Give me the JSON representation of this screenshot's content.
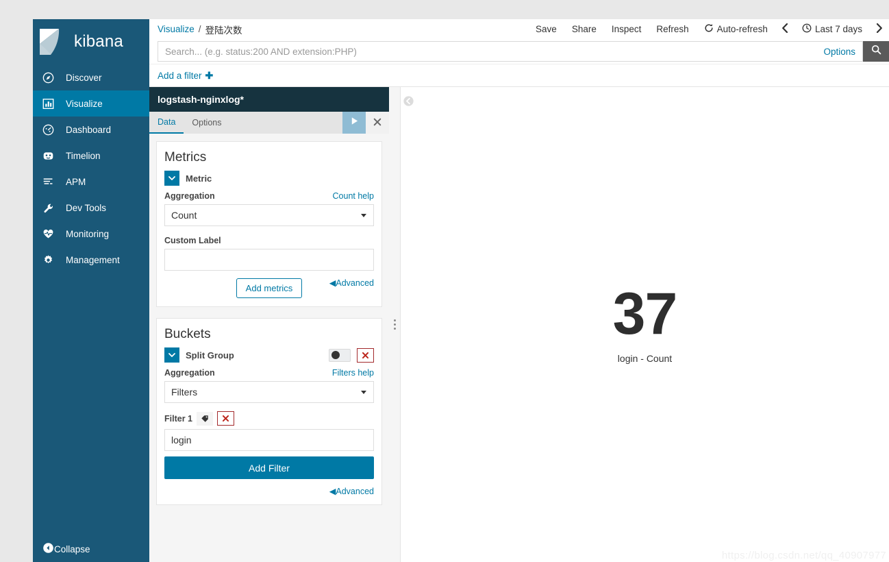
{
  "brand": {
    "name": "kibana",
    "logo_icon": "kibana-logo-icon"
  },
  "sidebar": {
    "items": [
      {
        "label": "Discover",
        "icon": "compass-icon",
        "active": false
      },
      {
        "label": "Visualize",
        "icon": "bar-chart-icon",
        "active": true
      },
      {
        "label": "Dashboard",
        "icon": "dashboard-gauge-icon",
        "active": false
      },
      {
        "label": "Timelion",
        "icon": "timelion-icon",
        "active": false
      },
      {
        "label": "APM",
        "icon": "apm-lines-icon",
        "active": false
      },
      {
        "label": "Dev Tools",
        "icon": "wrench-icon",
        "active": false
      },
      {
        "label": "Monitoring",
        "icon": "heartbeat-icon",
        "active": false
      },
      {
        "label": "Management",
        "icon": "gear-icon",
        "active": false
      }
    ],
    "collapse": {
      "label": "Collapse",
      "icon": "collapse-left-icon"
    }
  },
  "topnav": {
    "breadcrumb": {
      "parent": "Visualize",
      "separator": "/",
      "current": "登陆次数"
    },
    "actions": [
      "Save",
      "Share",
      "Inspect",
      "Refresh"
    ],
    "auto_refresh": {
      "label": "Auto-refresh",
      "icon": "refresh-cycle-icon"
    },
    "time_prev_icon": "chevron-left-icon",
    "time_next_icon": "chevron-right-icon",
    "time_range": {
      "label": "Last 7 days",
      "icon": "clock-icon"
    }
  },
  "query": {
    "value": "",
    "placeholder": "Search... (e.g. status:200 AND extension:PHP)",
    "options_label": "Options",
    "search_icon": "search-icon"
  },
  "filterbar": {
    "add_filter_label": "Add a filter",
    "plus_icon": "plus-icon"
  },
  "editor": {
    "index_pattern": "logstash-nginxlog*",
    "tabs": [
      {
        "label": "Data",
        "active": true
      },
      {
        "label": "Options",
        "active": false
      }
    ],
    "apply_icon": "play-apply-icon",
    "cancel_icon": "close-x-icon",
    "metrics": {
      "title": "Metrics",
      "agg_row_title": "Metric",
      "caret_icon": "chevron-down-icon",
      "aggregation_label": "Aggregation",
      "help_label": "Count help",
      "aggregation_value": "Count",
      "aggregation_options": [
        "Count"
      ],
      "custom_label_label": "Custom Label",
      "custom_label_value": "",
      "advanced_label": "Advanced",
      "advanced_caret": "◀",
      "add_metrics_label": "Add metrics"
    },
    "buckets": {
      "title": "Buckets",
      "agg_row_title": "Split Group",
      "caret_icon": "chevron-down-icon",
      "toggle_icon": "enable-toggle-icon",
      "remove_icon": "remove-x-icon",
      "aggregation_label": "Aggregation",
      "help_label": "Filters help",
      "aggregation_value": "Filters",
      "aggregation_options": [
        "Filters"
      ],
      "filter_label": "Filter 1",
      "filter_tag_icon": "label-tag-icon",
      "filter_remove_icon": "remove-x-icon",
      "filter_value": "login",
      "add_filter_label": "Add Filter",
      "advanced_label": "Advanced",
      "advanced_caret": "◀"
    }
  },
  "visualization": {
    "collapse_icon": "collapse-left-circle-icon",
    "drag_handle_icon": "drag-handle-icon",
    "metric_value": "37",
    "metric_label": "login - Count"
  },
  "watermark": "https://blog.csdn.net/qq_40907977",
  "colors": {
    "sidebar_bg": "#1a5878",
    "sidebar_active": "#0079a5",
    "panel_header_bg": "#16333f",
    "accent": "#0079a5",
    "danger": "#bd271e",
    "apply_btn": "#8fbcd4"
  },
  "chart_data": {
    "type": "table",
    "title": "登陆次数",
    "categories": [
      "login - Count"
    ],
    "values": [
      37
    ]
  }
}
